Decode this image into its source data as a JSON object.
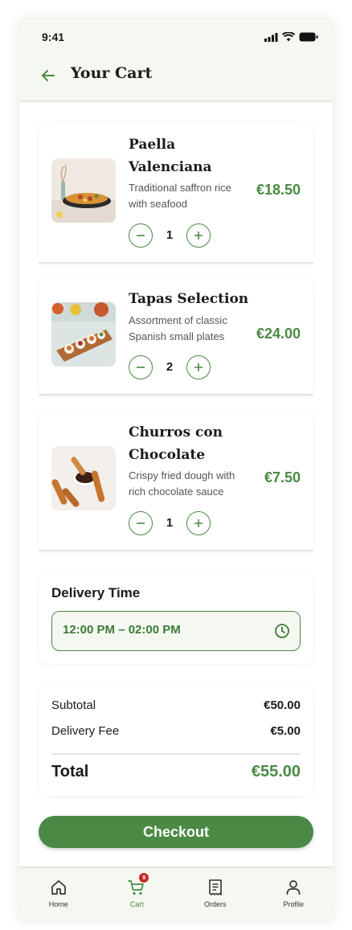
{
  "status_bar": {
    "time": "9:41"
  },
  "header": {
    "title": "Your Cart"
  },
  "items": [
    {
      "name": "Paella Valenciana",
      "description": "Traditional saffron rice with seafood",
      "price": "€18.50",
      "quantity": "1"
    },
    {
      "name": "Tapas Selection",
      "description": "Assortment of classic Spanish small plates",
      "price": "€24.00",
      "quantity": "2"
    },
    {
      "name": "Churros con Chocolate",
      "description": "Crispy fried dough with rich chocolate sauce",
      "price": "€7.50",
      "quantity": "1"
    }
  ],
  "delivery": {
    "title": "Delivery Time",
    "value": "12:00 PM – 02:00 PM"
  },
  "summary": {
    "subtotal_label": "Subtotal",
    "subtotal_value": "€50.00",
    "fee_label": "Delivery Fee",
    "fee_value": "€5.00",
    "total_label": "Total",
    "total_value": "€55.00"
  },
  "checkout_label": "Checkout",
  "tabs": [
    {
      "label": "Home",
      "icon": "home-icon"
    },
    {
      "label": "Cart",
      "icon": "cart-icon",
      "badge": "9"
    },
    {
      "label": "Orders",
      "icon": "receipt-icon"
    },
    {
      "label": "Profile",
      "icon": "person-icon"
    }
  ],
  "colors": {
    "accent": "#4a8a44",
    "background_tint": "#f4f8f1",
    "badge": "#c62828"
  }
}
